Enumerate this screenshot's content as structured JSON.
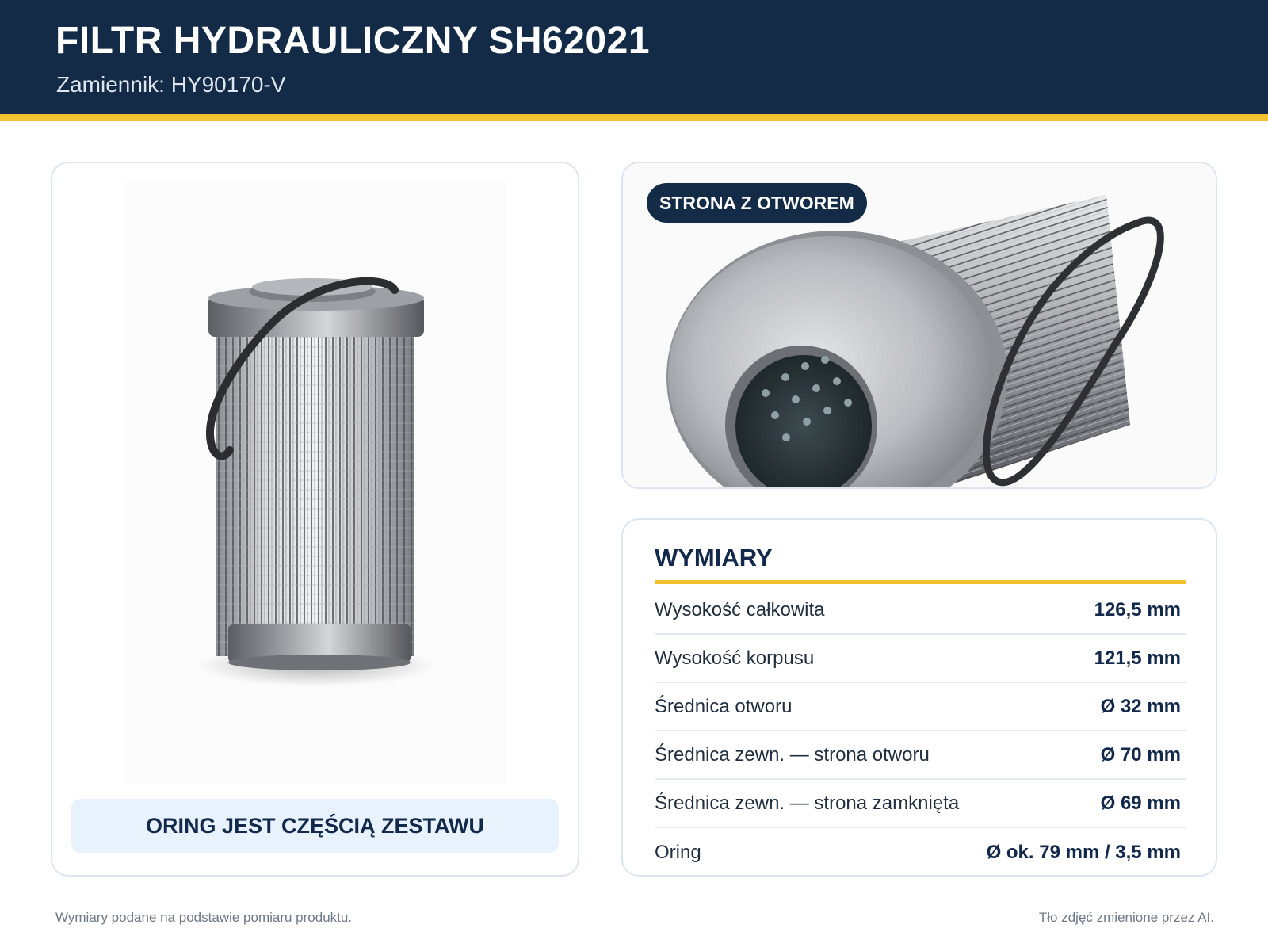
{
  "header": {
    "title": "FILTR HYDRAULICZNY SH62021",
    "subtitle": "Zamiennik: HY90170-V"
  },
  "left_card": {
    "banner": "ORING JEST CZĘŚCIĄ ZESTAWU"
  },
  "photo_card": {
    "badge": "STRONA Z OTWOREM"
  },
  "dimensions": {
    "title": "WYMIARY",
    "rows": [
      {
        "label": "Wysokość całkowita",
        "value": "126,5 mm"
      },
      {
        "label": "Wysokość korpusu",
        "value": "121,5 mm"
      },
      {
        "label": "Średnica otworu",
        "value": "Ø 32 mm"
      },
      {
        "label": "Średnica zewn. — strona otworu",
        "value": "Ø 70 mm"
      },
      {
        "label": "Średnica zewn. — strona zamknięta",
        "value": "Ø 69 mm"
      },
      {
        "label": "Oring",
        "value": "Ø ok. 79 mm / 3,5 mm"
      }
    ]
  },
  "footer": {
    "left": "Wymiary podane na podstawie pomiaru produktu.",
    "right": "Tło zdjęć zmienione przez AI."
  },
  "colors": {
    "header_bg": "#132b47",
    "accent_yellow": "#f2c12e",
    "banner_bg": "#e7f2fc",
    "text_dark": "#13294b"
  }
}
